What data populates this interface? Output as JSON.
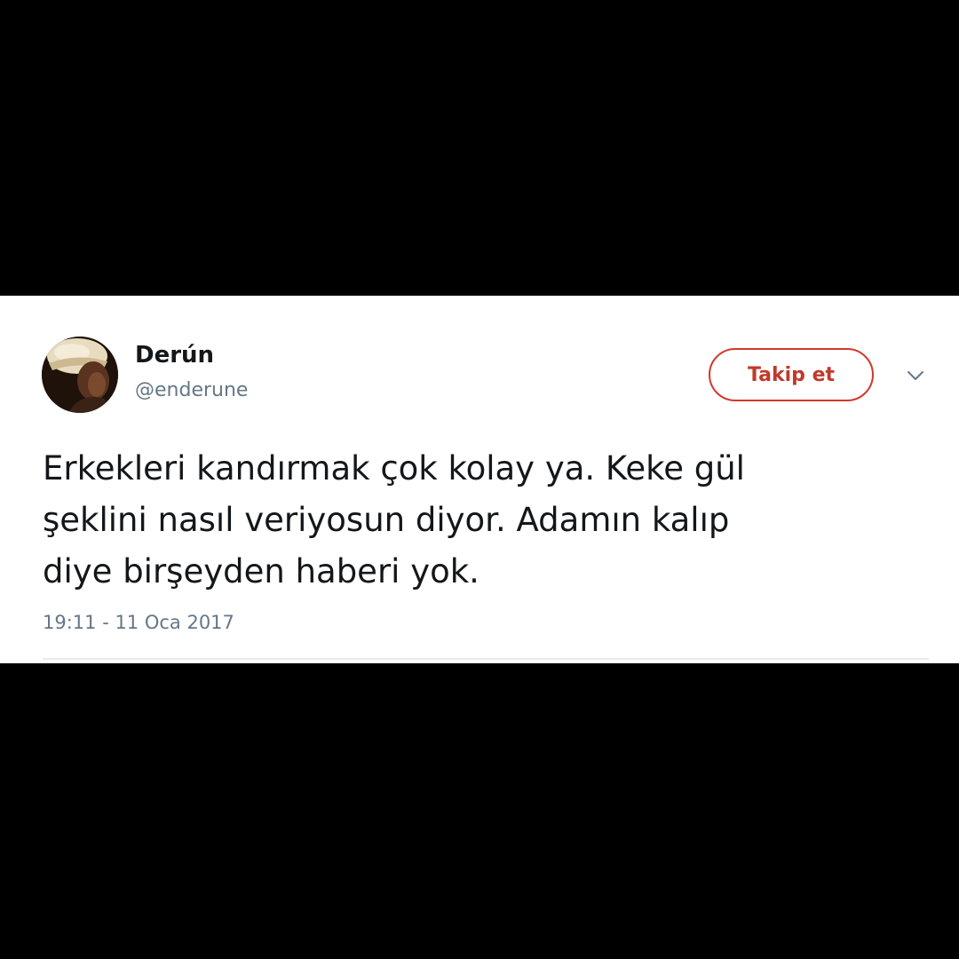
{
  "tweet": {
    "author": {
      "display_name": "Derún",
      "handle": "@enderune",
      "avatar_icon": "profile-photo"
    },
    "follow_button_label": "Takip et",
    "menu_icon": "chevron-down-icon",
    "text_lines": [
      "Erkekleri kandırmak çok kolay ya. Keke gül",
      "şeklini nasıl veriyosun diyor. Adamın kalıp",
      "diye birşeyden haberi yok."
    ],
    "timestamp": "19:11 - 11 Oca 2017"
  },
  "colors": {
    "background": "#000000",
    "card": "#ffffff",
    "follow_accent": "#c0392b",
    "secondary_text": "#657786",
    "primary_text": "#14171a"
  }
}
